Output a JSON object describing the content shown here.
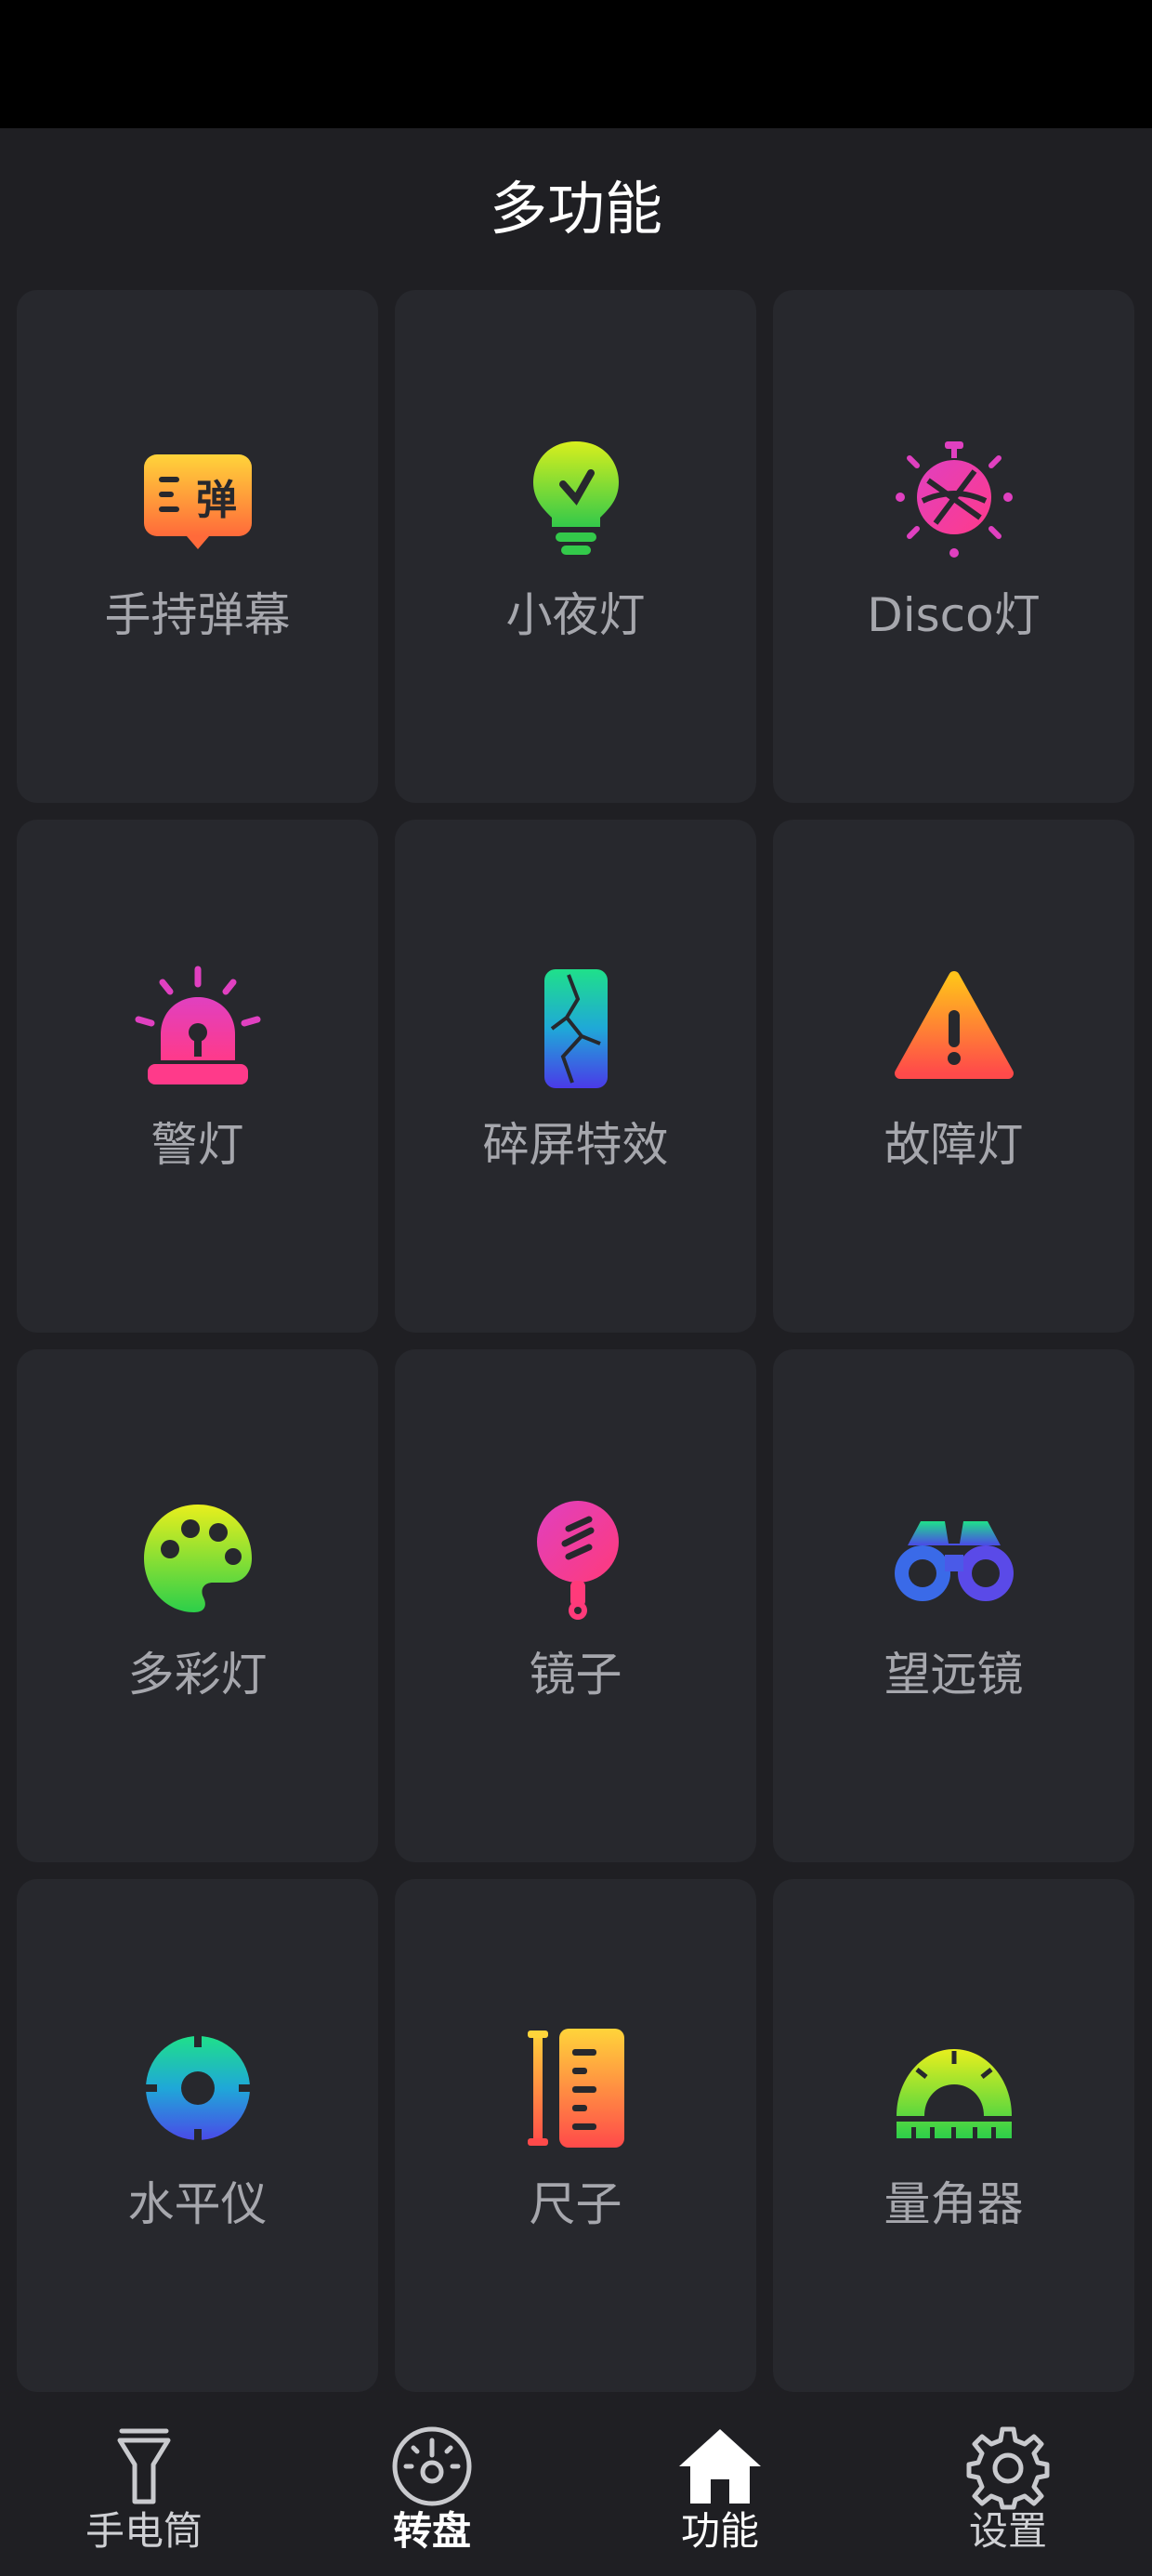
{
  "header": {
    "title": "多功能"
  },
  "tiles": [
    {
      "label": "手持弹幕",
      "icon": "barrage-bubble-icon"
    },
    {
      "label": "小夜灯",
      "icon": "night-light-bulb-icon"
    },
    {
      "label": "Disco灯",
      "icon": "disco-ball-icon"
    },
    {
      "label": "警灯",
      "icon": "police-siren-icon"
    },
    {
      "label": "碎屏特效",
      "icon": "cracked-screen-icon"
    },
    {
      "label": "故障灯",
      "icon": "warning-triangle-icon"
    },
    {
      "label": "多彩灯",
      "icon": "palette-icon"
    },
    {
      "label": "镜子",
      "icon": "hand-mirror-icon"
    },
    {
      "label": "望远镜",
      "icon": "binoculars-icon"
    },
    {
      "label": "水平仪",
      "icon": "level-gauge-icon"
    },
    {
      "label": "尺子",
      "icon": "ruler-icon"
    },
    {
      "label": "量角器",
      "icon": "protractor-icon"
    }
  ],
  "nav": {
    "items": [
      {
        "label": "手电筒",
        "icon": "flashlight-icon"
      },
      {
        "label": "转盘",
        "icon": "dial-icon"
      },
      {
        "label": "功能",
        "icon": "home-icon"
      },
      {
        "label": "设置",
        "icon": "gear-icon"
      }
    ],
    "active_index": 2
  },
  "colors": {
    "background": "#1f1f23",
    "tile": "#27282d",
    "label": "#a6a7ad",
    "status_bar": "#000000"
  }
}
